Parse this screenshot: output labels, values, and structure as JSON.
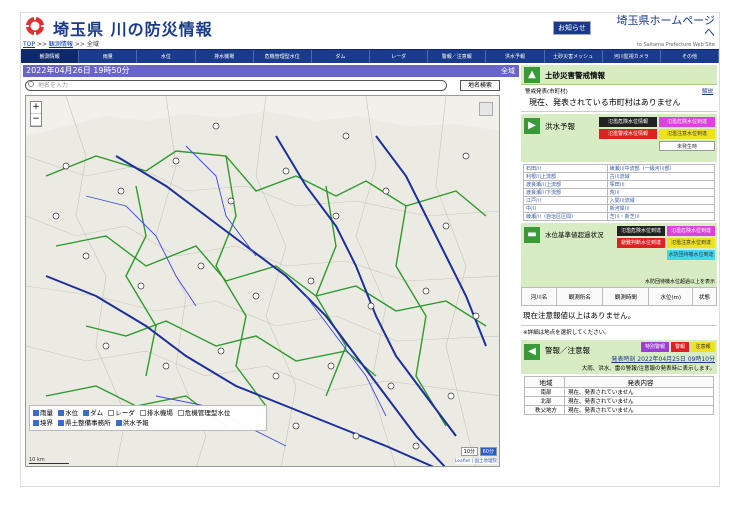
{
  "header": {
    "title": "埼玉県 川の防災情報",
    "oshirase": "お知らせ",
    "pref_link": "埼玉県ホームページへ",
    "pref_link_sub": "to Saitama Prefecture Web Site"
  },
  "breadcrumb": {
    "top": "TOP",
    "sep1": ">>",
    "overview": "観測情報",
    "sep2": ">>",
    "current": "全域"
  },
  "nav": [
    "観測情報",
    "雨量",
    "水位",
    "排水機場",
    "危機管理型水位",
    "ダム",
    "レーダ",
    "警報／注意報",
    "洪水予報",
    "土砂災害メッシュ",
    "河川監視カメラ",
    "その他"
  ],
  "timebar": {
    "datetime": "2022年04月26日 19時50分",
    "area": "全域"
  },
  "search": {
    "placeholder": "地名を入力",
    "button": "地名検索"
  },
  "map": {
    "zoom_in": "+",
    "zoom_out": "−",
    "legend": [
      {
        "label": "雨量",
        "checked": true
      },
      {
        "label": "水位",
        "checked": true
      },
      {
        "label": "ダム",
        "checked": true
      },
      {
        "label": "レーダ",
        "checked": false
      },
      {
        "label": "排水機場",
        "checked": false
      },
      {
        "label": "危機管理型水位",
        "checked": false
      },
      {
        "label": "境界",
        "checked": true
      },
      {
        "label": "県土整備事務所",
        "checked": true
      },
      {
        "label": "洪水予報",
        "checked": true
      }
    ],
    "scale": "10 km",
    "scale_buttons": [
      "10分",
      "60分"
    ],
    "attribution": "Leaflet | 国土地理院"
  },
  "dosha": {
    "title": "土砂災害警戒情報",
    "label": "警戒発表(市町村)",
    "help": "解説",
    "text": "現在、発表されている市町村はありません"
  },
  "flood": {
    "title": "洪水予報",
    "badges": [
      "氾濫危険水位情報",
      "氾濫危険水位到達",
      "氾濫警戒水位情報",
      "氾濫注意水位到達",
      "未発生時"
    ],
    "rivers": [
      [
        "石田川",
        "綾瀬川中流部（一級河川部）"
      ],
      [
        "利根川上流部",
        "古川流域"
      ],
      [
        "渡良瀬川上流部",
        "塚田川"
      ],
      [
        "渡良瀬川下流部",
        "荒川"
      ],
      [
        "江戸川",
        "入間川流域"
      ],
      [
        "中川",
        "新河岸川"
      ],
      [
        "綾瀬川（自治区区間）",
        "芝川・新芝川"
      ]
    ]
  },
  "over": {
    "title": "水位基準値超過状況",
    "badges": [
      "氾濫危険水位到達",
      "氾濫危険水位到達",
      "避難判断水位到達",
      "氾濫注意水位到達",
      "水防団待機水位到達"
    ],
    "note": "水防団待機水位超過以上を表示"
  },
  "obs": {
    "headers": [
      "河川名",
      "観測所名",
      "観測時間",
      "水位(m)",
      "状態"
    ],
    "message": "現在注意報値以上はありません。",
    "hint": "※詳細は地点を選択してください。"
  },
  "warn": {
    "title": "警報／注意報",
    "badges": [
      "特別警報",
      "警報",
      "注意報"
    ],
    "issued": "発表時刻 2022年04月25日 09時10分",
    "note": "大雨、洪水、雷の警報/注意報の発表時に表示します。",
    "headers": [
      "地域",
      "発表内容"
    ],
    "rows": [
      [
        "南部",
        "現在、発表されていません"
      ],
      [
        "北部",
        "現在、発表されていません"
      ],
      [
        "秩父地方",
        "現在、発表されていません"
      ]
    ]
  },
  "colors": {
    "nav_bg": "#1a3a8c",
    "timebar_bg": "#6a64c8",
    "panel_bg": "#d8ecc4",
    "logo_red": "#e03030"
  }
}
